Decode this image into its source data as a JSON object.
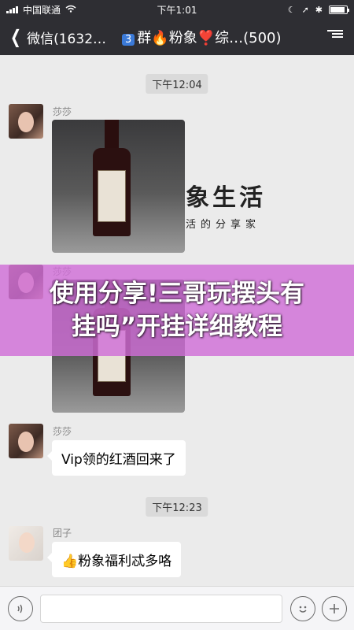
{
  "status_bar": {
    "carrier": "中国联通",
    "time": "下午1:01",
    "battery_level": 0.9
  },
  "nav": {
    "back_label": "微信(1632…",
    "title_number": "3",
    "title": "群🔥粉象❣️综…(500)"
  },
  "messages": {
    "time_1": "下午12:04",
    "sender_1": "莎莎",
    "sender_2": "莎莎",
    "sender_3": "莎莎",
    "text_3": "Vip领的红酒回来了",
    "time_2": "下午12:23",
    "sender_4": "团子",
    "text_4": "👍粉象福利忒多咯"
  },
  "watermark": {
    "big": "象生活",
    "small": "活的分享家"
  },
  "overlay": {
    "line_1": "使用分享!三哥玩摆头有",
    "line_2": "挂吗”开挂详细教程"
  },
  "icons": {
    "back": "chevron-left-icon",
    "more": "group-info-icon",
    "voice": "voice-icon",
    "emoji": "emoji-icon",
    "add": "add-icon"
  }
}
